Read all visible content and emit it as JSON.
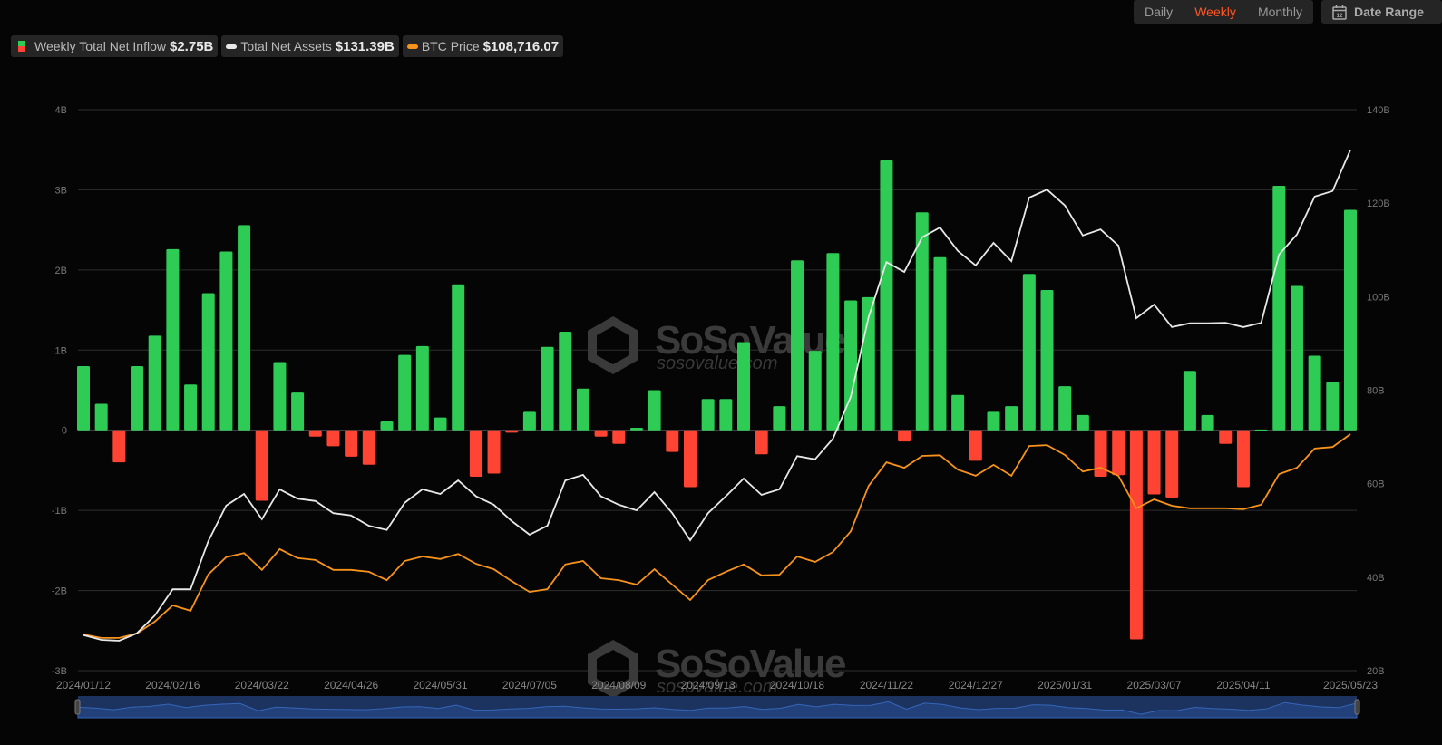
{
  "controls": {
    "periods": [
      "Daily",
      "Weekly",
      "Monthly"
    ],
    "active_period": "Weekly",
    "date_range_label": "Date Range",
    "calendar_day": "12"
  },
  "legend": [
    {
      "label": "Weekly Total Net Inflow",
      "value": "$2.75B"
    },
    {
      "label": "Total Net Assets",
      "value": "$131.39B"
    },
    {
      "label": "BTC Price",
      "value": "$108,716.07"
    }
  ],
  "watermark": {
    "brand": "SoSoValue",
    "site": "sosovalue.com"
  },
  "colors": {
    "positive": "#2ecc55",
    "negative": "#ff4433",
    "assets_line": "#e8e8e8",
    "btc_line": "#f7931a",
    "active": "#ff5522",
    "navigator": "#1c3360"
  },
  "chart_data": {
    "type": "bar",
    "title": "",
    "left_axis": {
      "ylim": [
        -3,
        4
      ],
      "ticks": [
        "-3B",
        "-2B",
        "-1B",
        "0",
        "1B",
        "2B",
        "3B",
        "4B"
      ],
      "tick_values": [
        -3,
        -2,
        -1,
        0,
        1,
        2,
        3,
        4
      ]
    },
    "right_axis": {
      "ylim": [
        20,
        140
      ],
      "ticks": [
        "20B",
        "40B",
        "60B",
        "80B",
        "100B",
        "120B",
        "140B"
      ],
      "tick_values": [
        20,
        40,
        60,
        80,
        100,
        120,
        140
      ]
    },
    "btc_ylim": [
      34650,
      210320
    ],
    "x_tick_labels": [
      "2024/01/12",
      "2024/02/16",
      "2024/03/22",
      "2024/04/26",
      "2024/05/31",
      "2024/07/05",
      "2024/08/09",
      "2024/09/13",
      "2024/10/18",
      "2024/11/22",
      "2024/12/27",
      "2025/01/31",
      "2025/03/07",
      "2025/04/11",
      "2025/05/23"
    ],
    "x_tick_indices": [
      0,
      5,
      10,
      15,
      20,
      25,
      30,
      35,
      40,
      45,
      50,
      55,
      60,
      65,
      71
    ],
    "series": [
      {
        "name": "Weekly Total Net Inflow",
        "unit": "B USD",
        "type": "bar",
        "values": [
          0.8,
          0.33,
          -0.4,
          0.8,
          1.18,
          2.26,
          0.57,
          1.71,
          2.23,
          2.56,
          -0.88,
          0.85,
          0.47,
          -0.08,
          -0.2,
          -0.33,
          -0.43,
          0.11,
          0.94,
          1.05,
          0.16,
          1.82,
          -0.58,
          -0.54,
          -0.03,
          0.23,
          1.04,
          1.23,
          0.52,
          -0.08,
          -0.17,
          0.03,
          0.5,
          -0.27,
          -0.71,
          0.39,
          0.39,
          1.1,
          -0.3,
          0.3,
          2.12,
          0.99,
          2.21,
          1.62,
          1.66,
          3.37,
          -0.14,
          2.72,
          2.16,
          0.44,
          -0.38,
          0.23,
          0.3,
          1.95,
          1.75,
          0.55,
          0.19,
          -0.58,
          -0.56,
          -2.61,
          -0.8,
          -0.84,
          0.74,
          0.19,
          -0.17,
          -0.71,
          0.01,
          3.05,
          1.8,
          0.93,
          0.6,
          2.75
        ]
      },
      {
        "name": "Total Net Assets",
        "unit": "B USD",
        "type": "line",
        "values": [
          27.6,
          26.6,
          26.4,
          28.0,
          31.8,
          37.4,
          37.4,
          47.7,
          55.3,
          57.8,
          52.4,
          58.8,
          56.8,
          56.3,
          53.7,
          53.2,
          51.0,
          50.1,
          55.9,
          58.8,
          57.8,
          60.7,
          57.3,
          55.5,
          52.0,
          49.1,
          51.0,
          60.7,
          61.9,
          57.3,
          55.5,
          54.3,
          58.2,
          53.7,
          47.9,
          53.7,
          57.3,
          61.1,
          57.6,
          58.8,
          65.9,
          65.2,
          69.6,
          78.6,
          95.6,
          107.4,
          105.3,
          112.7,
          114.8,
          109.8,
          106.7,
          111.5,
          107.6,
          121.2,
          122.9,
          119.5,
          113.1,
          114.4,
          110.9,
          95.4,
          98.3,
          93.5,
          94.3,
          94.3,
          94.4,
          93.5,
          94.4,
          109.0,
          113.3,
          121.4,
          122.6,
          131.39
        ]
      },
      {
        "name": "BTC Price",
        "unit": "USD",
        "type": "line",
        "values": [
          46000,
          44900,
          44900,
          46300,
          50000,
          55100,
          53400,
          64800,
          70200,
          71500,
          66200,
          72700,
          69900,
          69300,
          66200,
          66200,
          65600,
          63000,
          69000,
          70400,
          69600,
          71200,
          68100,
          66400,
          62700,
          59300,
          60200,
          67900,
          69000,
          63600,
          63000,
          61600,
          66400,
          61600,
          56800,
          63000,
          65600,
          67900,
          64500,
          64700,
          70400,
          68700,
          71800,
          78300,
          92500,
          99900,
          98200,
          101900,
          102100,
          97600,
          95700,
          99100,
          95700,
          105000,
          105300,
          102200,
          97000,
          98200,
          95700,
          85500,
          88300,
          86300,
          85500,
          85500,
          85500,
          85200,
          86600,
          96200,
          98200,
          104200,
          104700,
          108716.07
        ]
      }
    ]
  }
}
